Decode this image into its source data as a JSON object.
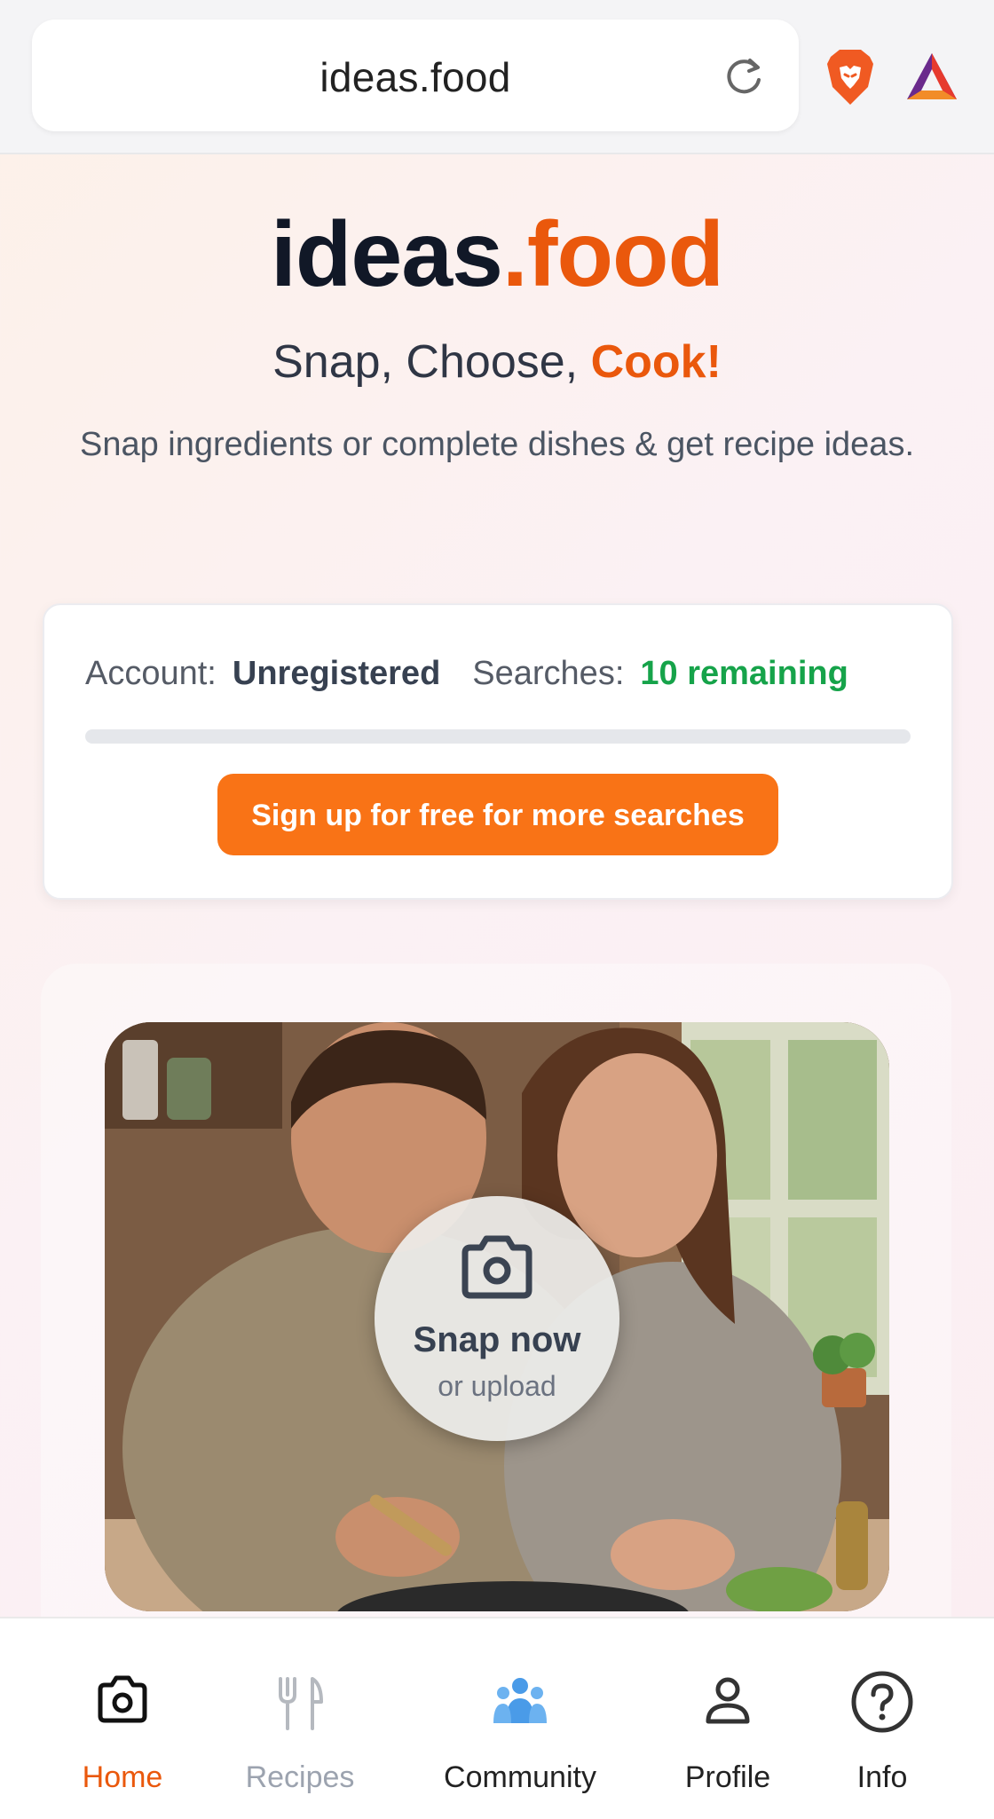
{
  "browser": {
    "url": "ideas.food"
  },
  "hero": {
    "brand_main": "ideas",
    "brand_accent": ".food",
    "tagline_main": "Snap, Choose, ",
    "tagline_accent": "Cook!",
    "subtitle": "Snap ingredients or complete dishes & get recipe ideas."
  },
  "account_card": {
    "account_label": "Account:",
    "account_value": "Unregistered",
    "searches_label": "Searches:",
    "searches_value": "10 remaining",
    "progress_fraction": 0,
    "signup_label": "Sign up for free for more searches"
  },
  "snap": {
    "title": "Snap now",
    "subtitle": "or upload"
  },
  "nav": {
    "home": "Home",
    "recipes": "Recipes",
    "community": "Community",
    "profile": "Profile",
    "info": "Info"
  },
  "colors": {
    "accent": "#ea580c",
    "button": "#f97316",
    "success": "#16a34a"
  }
}
